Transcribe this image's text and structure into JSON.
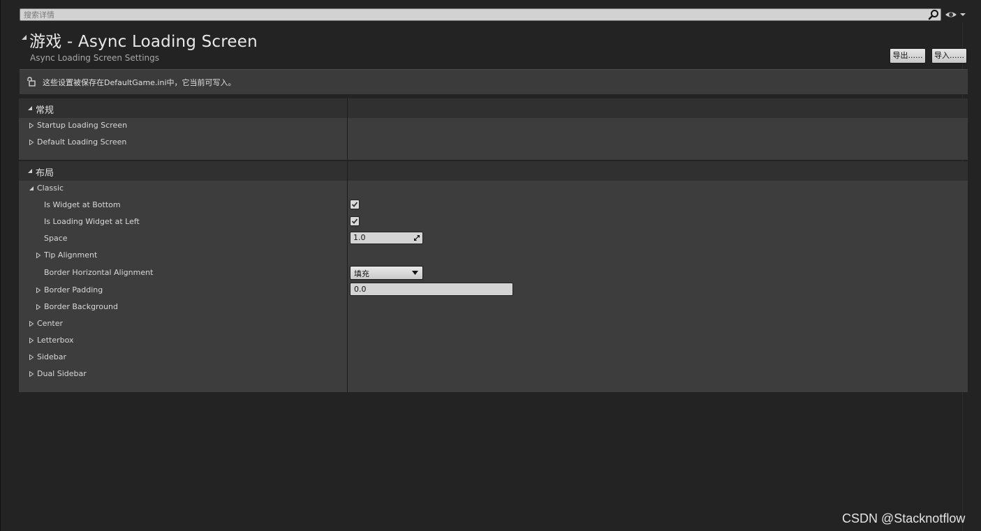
{
  "search": {
    "placeholder": "搜索详情"
  },
  "header": {
    "title": "游戏 - Async Loading Screen",
    "subtitle": "Async Loading Screen Settings",
    "export_label": "导出......",
    "import_label": "导入......"
  },
  "notice": {
    "text": "这些设置被保存在DefaultGame.ini中，它当前可写入。"
  },
  "categories": {
    "general": {
      "title": "常规",
      "items": [
        {
          "label": "Startup Loading Screen"
        },
        {
          "label": "Default Loading Screen"
        }
      ]
    },
    "layout": {
      "title": "布局",
      "classic": {
        "label": "Classic",
        "is_widget_at_bottom": {
          "label": "Is Widget at Bottom",
          "checked": true
        },
        "is_loading_widget_at_left": {
          "label": "Is Loading Widget at Left",
          "checked": true
        },
        "space": {
          "label": "Space",
          "value": "1.0"
        },
        "tip_alignment": {
          "label": "Tip Alignment"
        },
        "border_horizontal_alignment": {
          "label": "Border Horizontal Alignment",
          "value": "填充"
        },
        "border_padding": {
          "label": "Border Padding",
          "value": "0.0"
        },
        "border_background": {
          "label": "Border Background"
        }
      },
      "others": [
        {
          "label": "Center"
        },
        {
          "label": "Letterbox"
        },
        {
          "label": "Sidebar"
        },
        {
          "label": "Dual Sidebar"
        }
      ]
    }
  },
  "watermark": "CSDN @Stacknotflow",
  "colors": {
    "panel_bg": "#232323",
    "category_bg": "#3d3d3d",
    "header_bg": "#303030",
    "field_bg": "#d4d4d4"
  }
}
